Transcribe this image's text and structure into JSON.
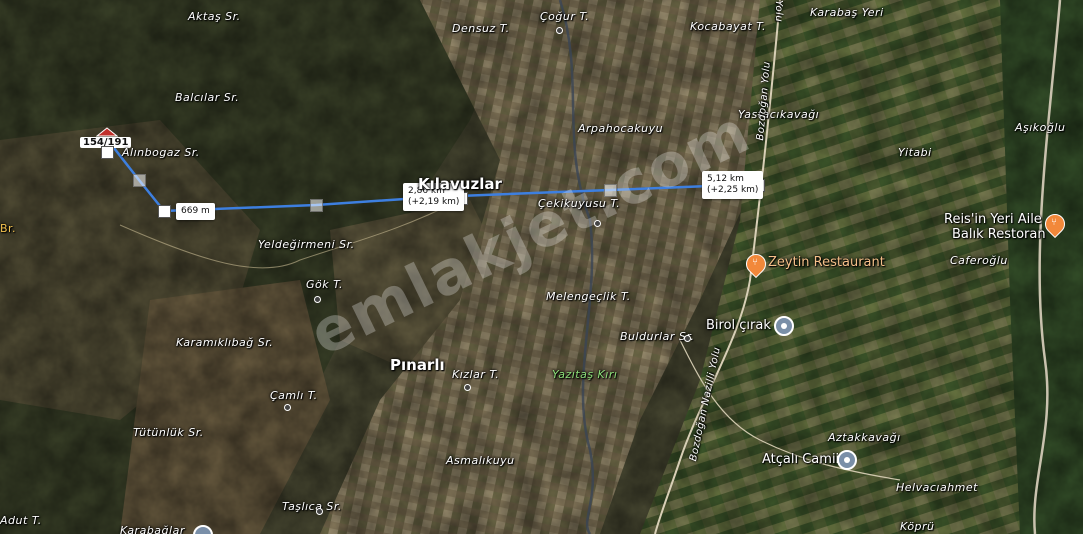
{
  "map": {
    "watermark": "emlakjet.com",
    "marker": {
      "label": "154/191"
    },
    "measurements": [
      {
        "distance": "669 m",
        "delta": ""
      },
      {
        "distance": "2,86 km",
        "delta": "(+2,19 km)"
      },
      {
        "distance": "5,12 km",
        "delta": "(+2,25 km)"
      }
    ],
    "places": {
      "aktas": "Aktaş Sr.",
      "cogur": "Çoğur T.",
      "densuz": "Densuz T.",
      "kocabayat": "Kocabayat T.",
      "karabas": "Karabaş Yeri",
      "balcilar": "Balcılar Sr.",
      "alinbogaz": "Alınbogaz Sr.",
      "kilavuzlar": "Kılavuzlar",
      "arpahocakuyu": "Arpahocakuyu",
      "yastacikavagi": "Yastacıkavağı",
      "asikoglu": "Aşıkoğlu",
      "yitabi": "Yitabi",
      "yeldegirmeni": "Yeldeğirmeni Sr.",
      "cekikuyusu": "Çekikuyusu T.",
      "gok": "Gök T.",
      "melengeclik": "Melengeçlik T.",
      "karamiklibag": "Karamıklıbağ Sr.",
      "buldurlar": "Buldurlar Sr.",
      "pinarli": "Pınarlı",
      "kizlar": "Kızlar T.",
      "yazitas": "Yazıtaş Kırı",
      "camli": "Çamlı T.",
      "tutunluk": "Tütünlük Sr.",
      "asmalikuyu": "Asmalıkuyu",
      "taslica": "Taşlıca Sr.",
      "adut": "Adut T.",
      "karabaglar": "Karabağlar",
      "br": "Br.",
      "caferoglu": "Caferoğlu",
      "aztakkavagi": "Aztakkavağı",
      "helvaciahmet": "Helvacıahmet",
      "kopru": "Köprü"
    },
    "roads": {
      "bozdogan_north": "Bozdoğan Yolu",
      "bozdogan_nazilli": "Bozdoğan Nazilli Yolu",
      "top": "Yolu"
    },
    "pois": {
      "reis_line1": "Reis'in Yeri Aile",
      "reis_line2": "Balık Restoran",
      "zeytin": "Zeytin Restaurant",
      "birol": "Birol çırak",
      "atcali": "Atçalı Camii"
    },
    "colors": {
      "route_line": "#3d7fe0",
      "poi_pin": "#f2883a",
      "place_pin": "#7a8fa8"
    },
    "icons": [
      "fork-knife-icon",
      "location-dot-icon",
      "mosque-icon",
      "house-marker-icon"
    ]
  }
}
